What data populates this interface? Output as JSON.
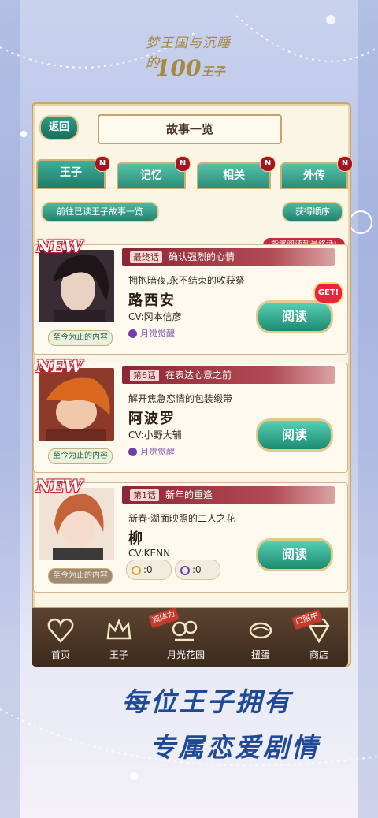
{
  "logo": {
    "line1": "梦王国与沉睡的",
    "line2_num": "100",
    "line2_text": "王子"
  },
  "header": {
    "back_label": "返回",
    "title": "故事一览"
  },
  "tabs": [
    {
      "label": "王子",
      "badge": "N",
      "active": true
    },
    {
      "label": "记忆",
      "badge": "N",
      "active": false
    },
    {
      "label": "相关",
      "badge": "N",
      "active": false
    },
    {
      "label": "外传",
      "badge": "N",
      "active": false
    }
  ],
  "actions": {
    "goto_read": "前往已读王子故事一览",
    "sort": "获得顺序"
  },
  "notice": "能够阅读到最终话!",
  "new_label": "NEW",
  "read_label": "阅读",
  "sofar_label": "至今为止的内容",
  "get_label": "GET!",
  "stories": [
    {
      "chapter_num": "最终话",
      "chapter_title": "确认强烈的心情",
      "desc": "拥抱暗夜,永不结束的收获祭",
      "name": "路西安",
      "cv": "CV:冈本信彦",
      "status": "月觉觉醒"
    },
    {
      "chapter_num": "第6话",
      "chapter_title": "在表达心意之前",
      "desc": "解开焦急恋情的包装缎带",
      "name": "阿波罗",
      "cv": "CV:小野大辅",
      "status": "月觉觉醒"
    },
    {
      "chapter_num": "第1话",
      "chapter_title": "新年的重逢",
      "desc": "新春·湖面映照的二人之花",
      "name": "柳",
      "cv": "CV:KENN",
      "count_gold": ":0",
      "count_moon": ":0"
    }
  ],
  "nav": [
    {
      "label": "首页",
      "icon": "heart-icon"
    },
    {
      "label": "王子",
      "icon": "crown-icon"
    },
    {
      "label": "月光花园",
      "icon": "garden-icon",
      "tag": "减体力"
    },
    {
      "label": "扭蛋",
      "icon": "gacha-icon"
    },
    {
      "label": "商店",
      "icon": "gem-icon",
      "tag": "口限中"
    }
  ],
  "slogan": {
    "line1": "每位王子拥有",
    "line2": "专属恋爱剧情"
  },
  "colors": {
    "accent_teal": "#2c8e79",
    "chapter_red": "#8b2734",
    "slogan_blue": "#1e4a98",
    "frame_gold": "#c9a56b"
  }
}
